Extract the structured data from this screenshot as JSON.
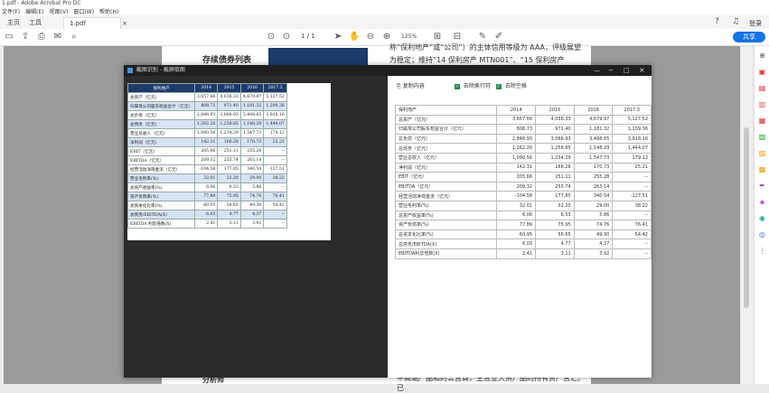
{
  "app": {
    "title": "1.pdf - Adobe Acrobat Pro DC"
  },
  "menu": [
    "文件(F)",
    "编辑(E)",
    "视图(V)",
    "窗口(W)",
    "帮助(H)"
  ],
  "tabs": {
    "home": "主页",
    "tools": "工具",
    "doc": "1.pdf"
  },
  "toolbar": {
    "page": "1",
    "page_total": "/ 1",
    "zoom": "125%",
    "share": "共享",
    "signin": "登录"
  },
  "document": {
    "heading": "存续债券列表",
    "line1": "称“保利地产”或“公司”）的主体信用等级为 AAA，评级展望",
    "line2": "为稳定；维持“14 保利房产 MTN001”、“15 保利房产 MTN001”，",
    "bottom_left": "分析师",
    "bottom_right": "中高端产品和的公营商，主营业大资产品的持有资产营汇。已"
  },
  "dialog": {
    "title": "截图识别 - 截屏取图",
    "tools": {
      "copy": "复制内容",
      "merge_rows": "去除换行符",
      "merge_cols": "去除空格"
    }
  },
  "left_table": {
    "headers": [
      "保利地产",
      "2014",
      "2015",
      "2016",
      "2017.3"
    ],
    "rows": [
      [
        "总资产（亿元）",
        "3,657.66",
        "4,038.33",
        "4,679.97",
        "5,127.52"
      ],
      [
        "归属母公司股东权益合计（亿元）",
        "808.73",
        "971.40",
        "1,181.32",
        "1,209.36"
      ],
      [
        "总负债（亿元）",
        "2,848.93",
        "3,066.93",
        "3,498.65",
        "3,918.16"
      ],
      [
        "总债务（亿元）",
        "1,262.20",
        "1,258.85",
        "1,148.29",
        "1,444.07"
      ],
      [
        "营业总收入（亿元）",
        "1,090.56",
        "1,234.29",
        "1,547.73",
        "179.12"
      ],
      [
        "净利润（亿元）",
        "142.31",
        "168.28",
        "170.73",
        "25.21"
      ],
      [
        "EBIT（亿元）",
        "205.66",
        "251.11",
        "255.28",
        "--"
      ],
      [
        "EBITDA（亿元）",
        "209.32",
        "255.74",
        "263.14",
        "--"
      ],
      [
        "经营活动净现金流（亿元）",
        "-104.58",
        "177.85",
        "340.54",
        "-127.51"
      ],
      [
        "营业毛利率(%)",
        "32.01",
        "32.20",
        "29.00",
        "38.22"
      ],
      [
        "总资产收益率(%)",
        "6.06",
        "6.53",
        "5.86",
        "--"
      ],
      [
        "资产负债率(%)",
        "77.89",
        "75.95",
        "74.76",
        "76.41"
      ],
      [
        "总资本化比率(%)",
        "60.95",
        "56.65",
        "49.30",
        "54.42"
      ],
      [
        "总债务/EBITDA(X)",
        "6.03",
        "4.77",
        "4.37",
        "--"
      ],
      [
        "EBITDA 利息倍数(X)",
        "2.41",
        "3.11",
        "3.92",
        "--"
      ]
    ]
  },
  "right_table": {
    "headers": [
      "保利地产",
      "2014",
      "2015",
      "2016",
      "2017.3"
    ],
    "rows": [
      [
        "总资产（亿元）",
        "3,657.66",
        "4,038.33",
        "4,679.97",
        "5,127.52"
      ],
      [
        "归属母公司股东权益合计（亿元）",
        "808.73",
        "971.40",
        "1,181.32",
        "1,209.36"
      ],
      [
        "总负债（亿元）",
        "2,848.93",
        "3,066.93",
        "3,498.65",
        "3,918.16"
      ],
      [
        "总债务（亿元）",
        "1,262.20",
        "1,258.85",
        "1,148.29",
        "1,444.07"
      ],
      [
        "营业总收入（亿元）",
        "1,090.56",
        "1,234.29",
        "1,547.73",
        "179.12"
      ],
      [
        "净利润（亿元）",
        "142.31",
        "168.28",
        "170.73",
        "25.21"
      ],
      [
        "EBIT（亿元）",
        "205.66",
        "251.11",
        "255.28",
        "--"
      ],
      [
        "EBITDA（亿元）",
        "209.32",
        "255.74",
        "263.14",
        "--"
      ],
      [
        "经营活动净现金流（亿元）",
        "-104.58",
        "177.85",
        "340.54",
        "-127.51"
      ],
      [
        "营业毛利率(%)",
        "32.01",
        "32.20",
        "29.00",
        "38.22"
      ],
      [
        "总资产收益率(%)",
        "6.06",
        "6.53",
        "5.86",
        "--"
      ],
      [
        "资产负债率(%)",
        "77.89",
        "75.95",
        "74.76",
        "76.41"
      ],
      [
        "总资本化比率(%)",
        "60.95",
        "56.65",
        "49.30",
        "54.42"
      ],
      [
        "总债务/EBITDA(X)",
        "6.03",
        "4.77",
        "4.37",
        "--"
      ],
      [
        "EBITDA利息倍数(X)",
        "2.41",
        "3.11",
        "3.92",
        "--"
      ]
    ]
  },
  "colors": {
    "accent": "#1473e6",
    "header_navy": "#1d3b6b",
    "dialog_dark": "#2b2b2b",
    "check_green": "#2e8b57"
  },
  "icons": [
    "save-icon",
    "upload-icon",
    "print-icon",
    "mail-icon",
    "search-icon",
    "help-icon",
    "bell-icon"
  ]
}
